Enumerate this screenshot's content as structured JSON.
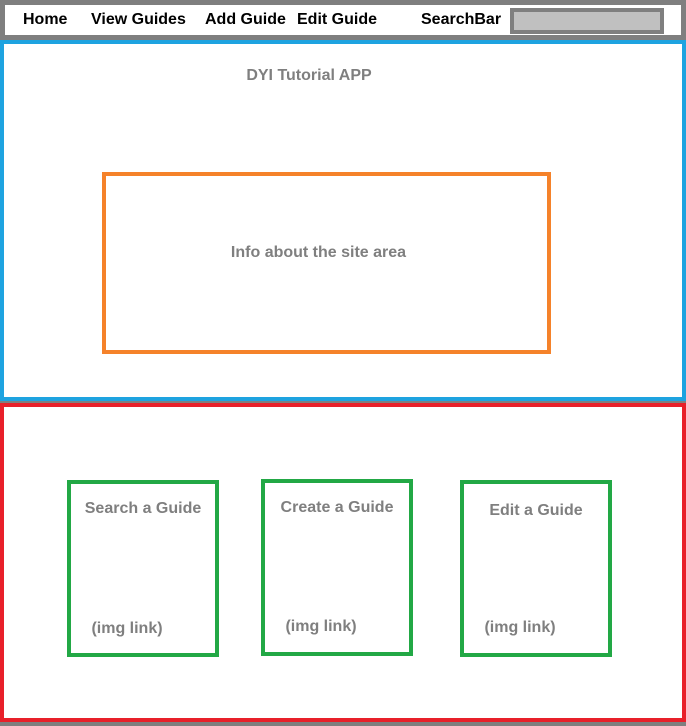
{
  "nav": {
    "items": [
      {
        "label": "Home"
      },
      {
        "label": "View Guides"
      },
      {
        "label": "Add Guide"
      },
      {
        "label": "Edit Guide"
      }
    ],
    "search_label": "SearchBar",
    "search_value": ""
  },
  "hero": {
    "title": "DYI Tutorial APP",
    "info_text": "Info about the site area"
  },
  "cards": [
    {
      "title": "Search a Guide",
      "link_text": "(img link)"
    },
    {
      "title": "Create a Guide",
      "link_text": "(img link)"
    },
    {
      "title": "Edit a Guide",
      "link_text": "(img link)"
    }
  ],
  "colors": {
    "nav_gray": "#7f7f7f",
    "hero_border": "#1ea3e0",
    "info_border": "#f5822a",
    "cards_border": "#e8202a",
    "card_border": "#22a845",
    "text_gray": "#7f7f7f"
  }
}
